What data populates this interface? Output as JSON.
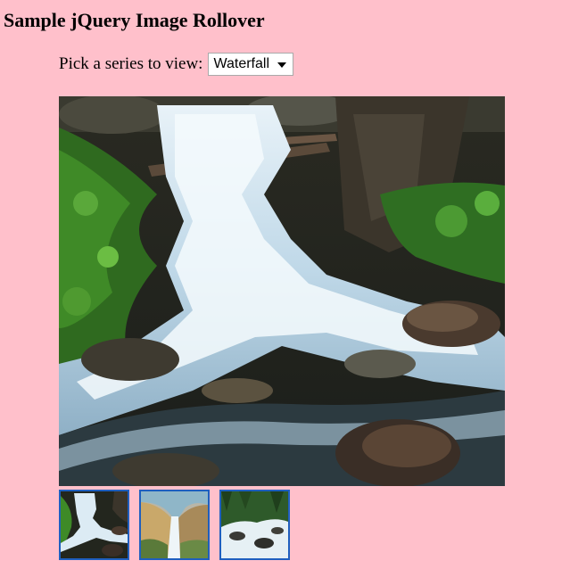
{
  "page": {
    "title": "Sample jQuery Image Rollover",
    "background_color": "#ffc0cb"
  },
  "series_picker": {
    "label": "Pick a series to view:",
    "selected": "Waterfall"
  },
  "main_image": {
    "subject": "cascading forest stream waterfall"
  },
  "thumbnails": [
    {
      "subject": "forest stream waterfall"
    },
    {
      "subject": "canyon waterfall"
    },
    {
      "subject": "river rapids among pines"
    }
  ],
  "colors": {
    "thumbnail_border": "#1f5fbf"
  }
}
